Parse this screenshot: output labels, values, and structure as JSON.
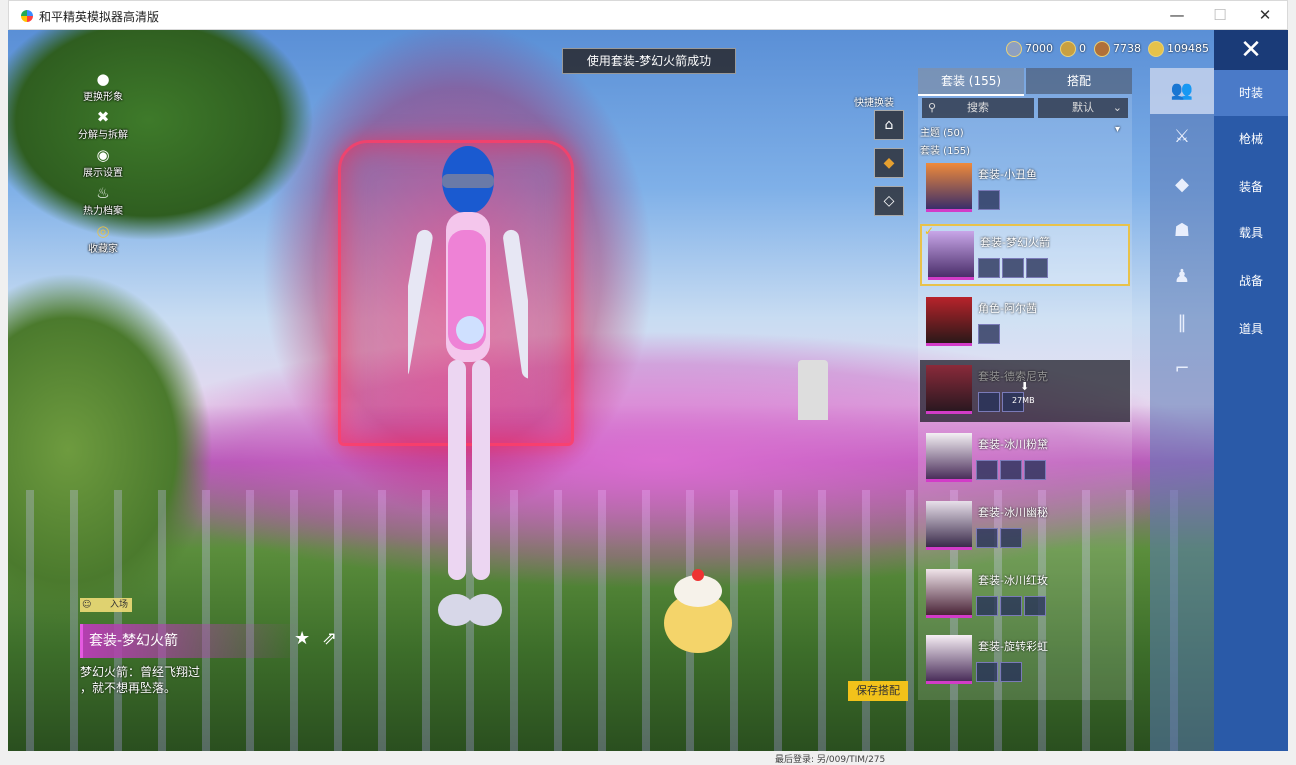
{
  "window": {
    "title": "和平精英模拟器高清版",
    "minimize": "—",
    "maximize": "☐",
    "close": "✕"
  },
  "left_menu": [
    {
      "icon": "person-icon",
      "label": "更换形象"
    },
    {
      "icon": "disassemble-icon",
      "label": "分解与拆解"
    },
    {
      "icon": "eye-icon",
      "label": "展示设置"
    },
    {
      "icon": "fire-icon",
      "label": "热力档案"
    },
    {
      "icon": "collection-icon",
      "label": "收藏家"
    }
  ],
  "toast": "使用套装-梦幻火箭成功",
  "currencies": [
    {
      "icon": "silver-coin-icon",
      "value": "7000",
      "color": "#8ea0c0"
    },
    {
      "icon": "gold-coin-icon",
      "value": "0",
      "color": "#c9a040"
    },
    {
      "icon": "bronze-coin-icon",
      "value": "7738",
      "color": "#b0703a"
    },
    {
      "icon": "gem-coin-icon",
      "value": "109485",
      "color": "#e6c24a"
    }
  ],
  "shortcut_label": "快捷换装",
  "panel": {
    "tabs": [
      {
        "label": "套装 (155)",
        "active": true
      },
      {
        "label": "搭配",
        "active": false
      }
    ],
    "search_label": "搜索",
    "sort_label": "默认",
    "theme_filter": "主题 (50)",
    "suit_count": "套装 (155)",
    "items": [
      {
        "name": "套装-小丑鱼",
        "selected": false,
        "dim": false,
        "minis": 1
      },
      {
        "name": "套装-梦幻火箭",
        "selected": true,
        "dim": false,
        "minis": 3
      },
      {
        "name": "角色-阿尔茜",
        "selected": false,
        "dim": false,
        "minis": 1
      },
      {
        "name": "套装-德索尼克",
        "selected": false,
        "dim": true,
        "minis": 2,
        "download": "27MB"
      },
      {
        "name": "套装-冰川粉黛",
        "selected": false,
        "dim": false,
        "minis": 3
      },
      {
        "name": "套装-冰川幽秘",
        "selected": false,
        "dim": false,
        "minis": 2
      },
      {
        "name": "套装-冰川红玫",
        "selected": false,
        "dim": false,
        "minis": 3
      },
      {
        "name": "套装-旋转彩虹",
        "selected": false,
        "dim": false,
        "minis": 2
      }
    ]
  },
  "categories": [
    {
      "label": "时装",
      "active": true
    },
    {
      "label": "枪械",
      "active": false
    },
    {
      "label": "装备",
      "active": false
    },
    {
      "label": "载具",
      "active": false
    },
    {
      "label": "战备",
      "active": false
    },
    {
      "label": "道具",
      "active": false
    }
  ],
  "sidebar_icons": [
    "outfit-icon",
    "armor-icon",
    "backpack-icon",
    "helmet-icon",
    "outfit-icon",
    "pants-icon",
    "shoes-icon"
  ],
  "bottom": {
    "intro_badge": "入场",
    "item_name": "套装-梦幻火箭",
    "description_line1": "梦幻火箭：曾经飞翔过",
    "description_line2": "，就不想再坠落。"
  },
  "save_button": "保存搭配",
  "behind_text": "最后登录: 另/009/TIM/275"
}
